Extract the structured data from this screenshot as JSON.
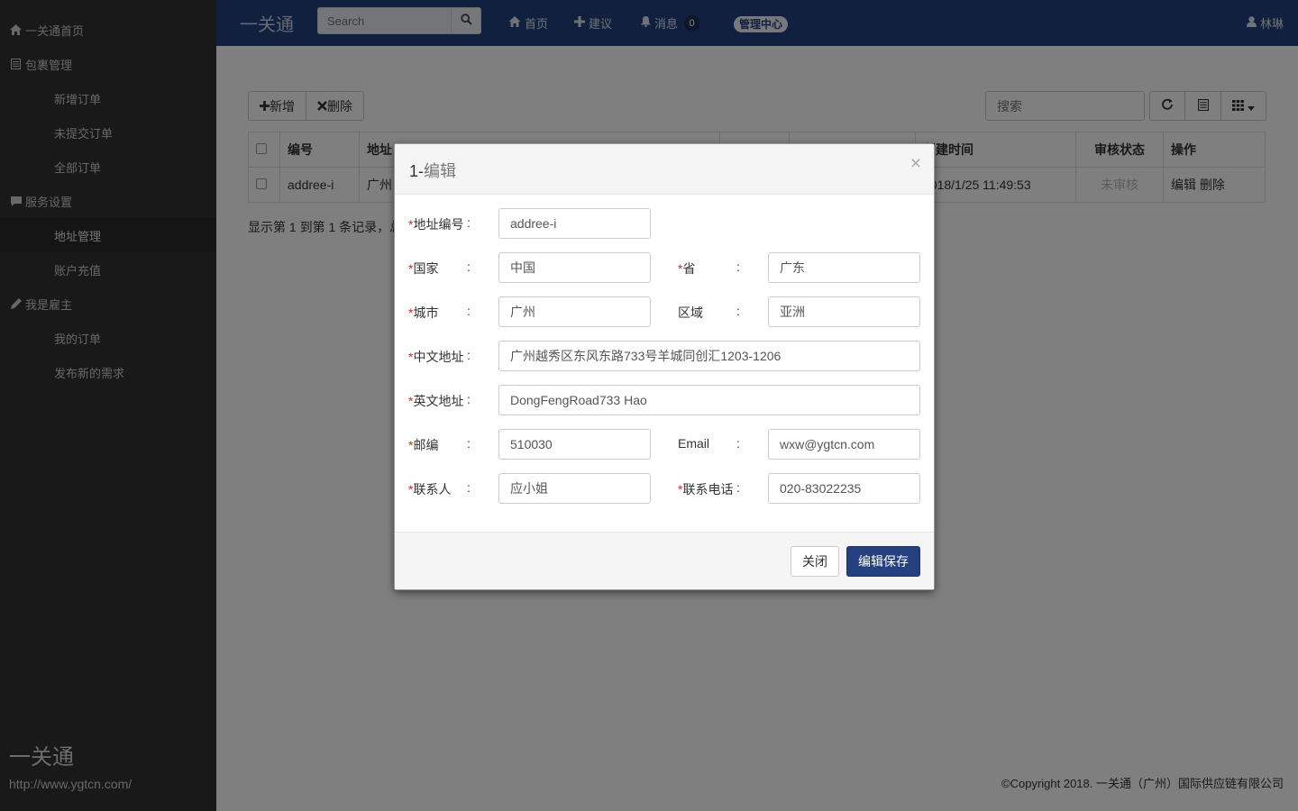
{
  "sidebar": {
    "home": "一关通首页",
    "package_mgmt": "包裹管理",
    "new_order": "新增订单",
    "unsubmitted_orders": "未提交订单",
    "all_orders": "全部订单",
    "service_settings": "服务设置",
    "address_mgmt": "地址管理",
    "account_recharge": "账户充值",
    "employer": "我是雇主",
    "my_orders": "我的订单",
    "publish_demand": "发布新的需求",
    "logo": "一关通",
    "url": "http://www.ygtcn.com/"
  },
  "navbar": {
    "brand": "一关通",
    "search_placeholder": "Search",
    "home": "首页",
    "suggest": "建议",
    "messages": "消息",
    "message_count": "0",
    "admin": "管理中心",
    "user": "林琳"
  },
  "toolbar": {
    "add": "新增",
    "delete": "删除",
    "search_placeholder": "搜索"
  },
  "table": {
    "headers": {
      "code": "编号",
      "address": "地址",
      "created": "创建时间",
      "status": "审核状态",
      "actions": "操作"
    },
    "row": {
      "code": "addree-i",
      "address": "广州",
      "created": "2018/1/25 11:49:53",
      "status": "未审核",
      "edit": "编辑",
      "delete": "删除"
    },
    "pager": "显示第 1 到第 1 条记录，总"
  },
  "footer": "©Copyright 2018. 一关通（广州）国际供应链有限公司",
  "modal": {
    "title_prefix": "1-",
    "title_rest": "编辑",
    "close_x": "×",
    "labels": {
      "address_code": "地址编号",
      "country": "国家",
      "province": "省",
      "city": "城市",
      "region": "区域",
      "cn_address": "中文地址",
      "en_address": "英文地址",
      "postcode": "邮编",
      "email": "Email",
      "contact": "联系人",
      "phone": "联系电话"
    },
    "required_mark": "*",
    "colon": ":",
    "values": {
      "address_code": "addree-i",
      "country": "中国",
      "province": "广东",
      "city": "广州",
      "region": "亚洲",
      "cn_address": "广州越秀区东风东路733号羊城同创汇1203-1206",
      "en_address": "DongFengRoad733 Hao",
      "postcode": "510030",
      "email": "wxw@ygtcn.com",
      "contact": "应小姐",
      "phone": "020-83022235"
    },
    "close_button": "关闭",
    "save_button": "编辑保存"
  }
}
